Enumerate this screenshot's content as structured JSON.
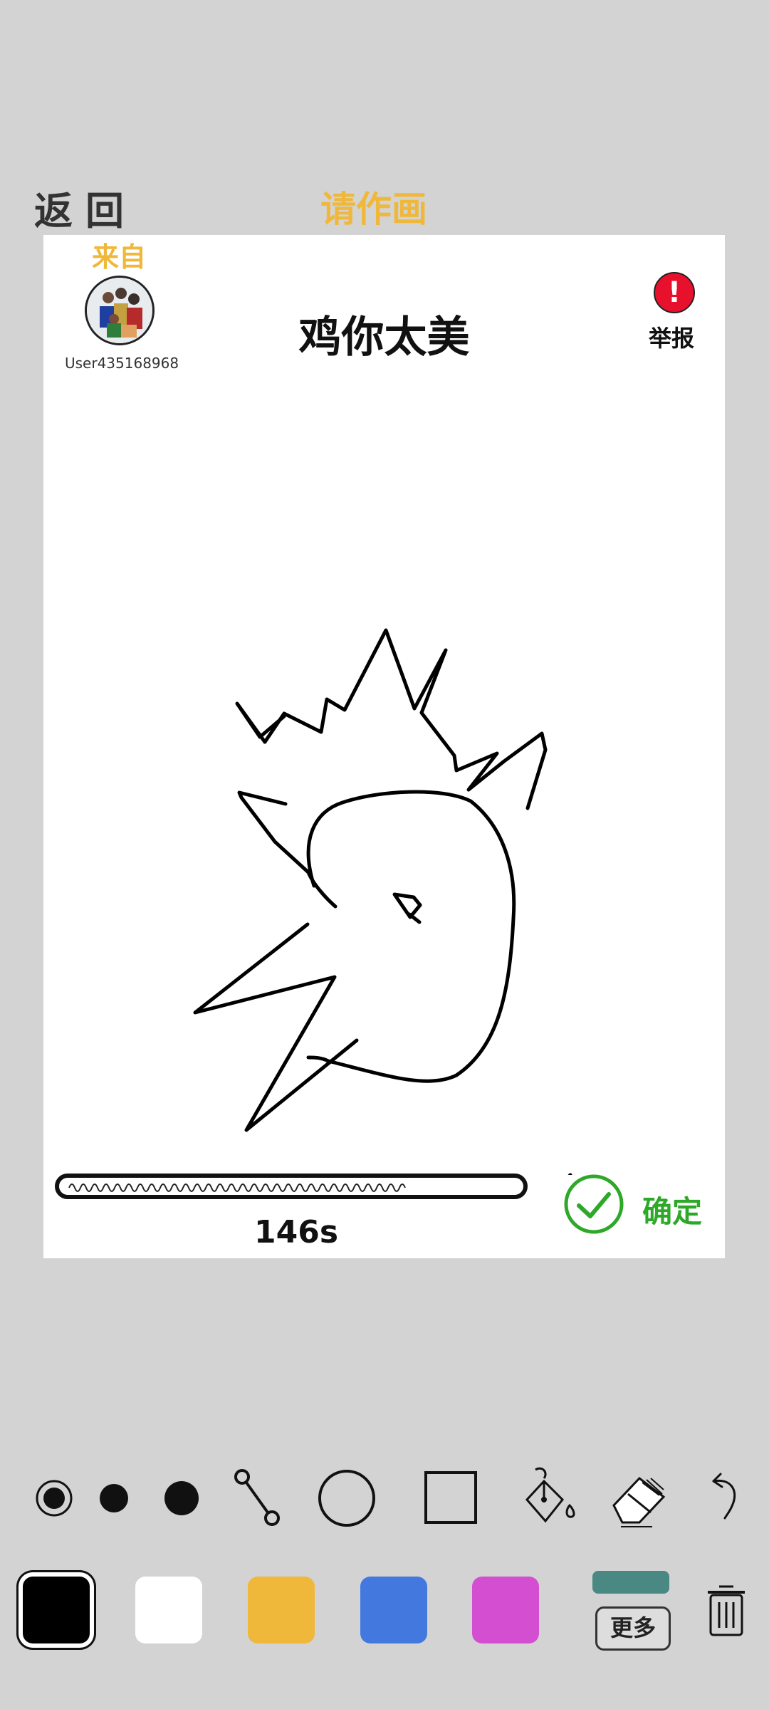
{
  "header": {
    "back_label": "返回",
    "title": "请作画"
  },
  "card": {
    "from_label": "来自",
    "username": "User435168968",
    "prompt_word": "鸡你太美",
    "report_label": "举报",
    "timer": "146s",
    "confirm_label": "确定"
  },
  "toolbar": {
    "tools": [
      "brush-size-small-selected",
      "brush-size-medium",
      "brush-size-large",
      "line-tool",
      "circle-tool",
      "rectangle-tool",
      "fill-bucket-tool",
      "eraser-tool",
      "undo"
    ],
    "colors": [
      {
        "name": "black",
        "hex": "#000000",
        "selected": true
      },
      {
        "name": "white",
        "hex": "#ffffff",
        "selected": false
      },
      {
        "name": "yellow",
        "hex": "#f0b83a",
        "selected": false
      },
      {
        "name": "blue",
        "hex": "#4378df",
        "selected": false
      },
      {
        "name": "magenta",
        "hex": "#d34ed1",
        "selected": false
      }
    ],
    "more_label": "更多"
  },
  "accent_colors": {
    "title": "#f0b83a",
    "confirm": "#2ea829",
    "report": "#e8112d"
  }
}
